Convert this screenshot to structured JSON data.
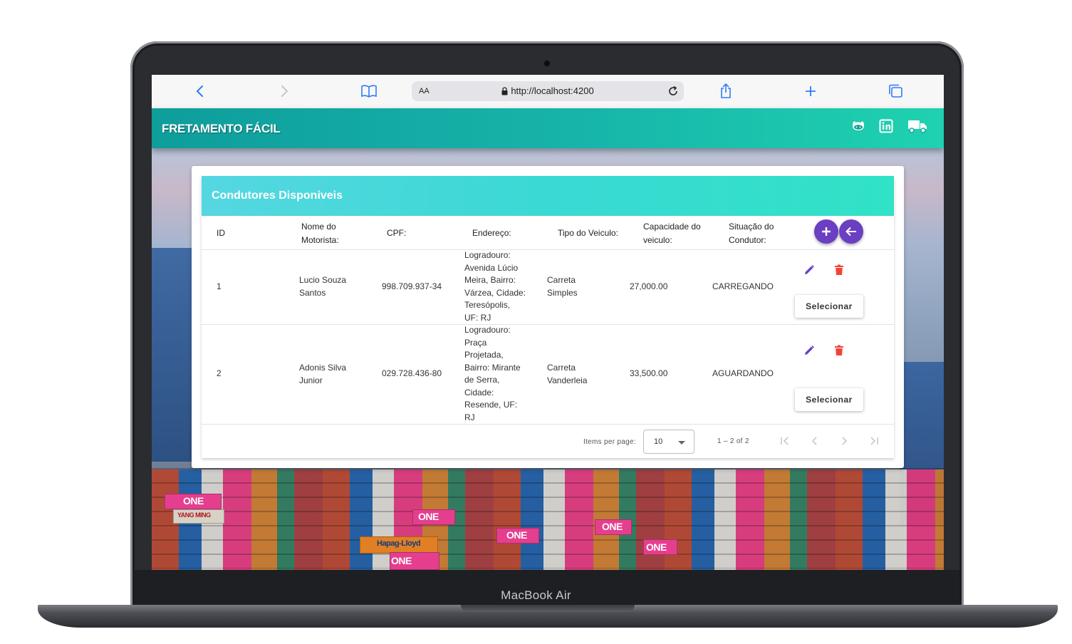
{
  "device": {
    "brand_label": "MacBook Air"
  },
  "browser": {
    "text_size_label": "AA",
    "url": "http://localhost:4200"
  },
  "app": {
    "title": "FRETAMENTO FÁCIL",
    "header_icons": [
      "github-icon",
      "linkedin-icon",
      "truck-icon"
    ]
  },
  "card": {
    "title": "Condutores Disponiveis",
    "columns": {
      "id": "ID",
      "nome_l1": "Nome do",
      "nome_l2": "Motorista:",
      "cpf": "CPF:",
      "endereco": "Endereço:",
      "tipo": "Tipo do Veiculo:",
      "cap_l1": "Capacidade do",
      "cap_l2": "veiculo:",
      "sit_l1": "Situação do",
      "sit_l2": "Condutor:"
    },
    "rows": [
      {
        "id": "1",
        "nome_l1": "Lucio Souza",
        "nome_l2": "Santos",
        "cpf": "998.709.937-34",
        "end": [
          "Logradouro:",
          "Avenida Lúcio",
          "Meira, Bairro:",
          "Várzea, Cidade:",
          "Teresópolis,",
          "UF: RJ"
        ],
        "tipo_l1": "Carreta",
        "tipo_l2": "Simples",
        "capacidade": "27,000.00",
        "situacao": "CARREGANDO",
        "action_label": "Selecionar"
      },
      {
        "id": "2",
        "nome_l1": "Adonis Silva",
        "nome_l2": "Junior",
        "cpf": "029.728.436-80",
        "end": [
          "Logradouro:",
          "Praça",
          "Projetada,",
          "Bairro: Mirante",
          "de Serra,",
          "Cidade:",
          "Resende, UF:",
          "RJ"
        ],
        "tipo_l1": "Carreta",
        "tipo_l2": "Vanderleia",
        "capacidade": "33,500.00",
        "situacao": "AGUARDANDO",
        "action_label": "Selecionar"
      }
    ],
    "paginator": {
      "items_per_page_label": "Items per page:",
      "page_size": "10",
      "range_label": "1 – 2 of 2"
    }
  },
  "background": {
    "container_logos": [
      "ONE",
      "YANG MING",
      "Hapag-Lloyd",
      "ONE",
      "ONE",
      "ONE",
      "ONE",
      "ONE"
    ]
  },
  "colors": {
    "header_gradient_start": "#0e9d9b",
    "header_gradient_end": "#1fd2b0",
    "card_header": "#3ad9d4",
    "fab": "#6a3fc2",
    "edit_icon": "#6a3fc2",
    "delete_icon": "#f44336",
    "browser_accent": "#2f7bf6"
  }
}
